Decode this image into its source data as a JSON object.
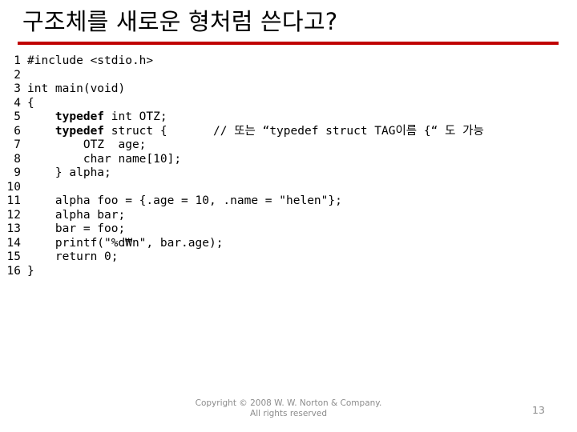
{
  "slide": {
    "title": "구조체를 새로운 형처럼 쓴다고?",
    "accent_color": "#C00000",
    "background_color": "#FFFFFF",
    "text_color": "#000000",
    "footer_color": "#8C8C8C"
  },
  "code": {
    "lines": [
      {
        "number": "1",
        "text": "#include <stdio.h>"
      },
      {
        "number": "2",
        "text": ""
      },
      {
        "number": "3",
        "text": "int main(void)"
      },
      {
        "number": "4",
        "text": "{"
      },
      {
        "number": "5",
        "keyword": "typedef",
        "text": " int OTZ;",
        "indent": "    "
      },
      {
        "number": "6",
        "keyword": "typedef",
        "text": " struct {",
        "indent": "    ",
        "comment": "// 또는 “typedef struct TAG이름 {“ 도 가능"
      },
      {
        "number": "7",
        "text": "        OTZ  age;"
      },
      {
        "number": "8",
        "text": "        char name[10];"
      },
      {
        "number": "9",
        "text": "    } alpha;"
      },
      {
        "number": "10",
        "text": ""
      },
      {
        "number": "11",
        "text": "    alpha foo = {.age = 10, .name = \"helen\"};"
      },
      {
        "number": "12",
        "text": "    alpha bar;"
      },
      {
        "number": "13",
        "text": "    bar = foo;"
      },
      {
        "number": "14",
        "text": "    printf(\"%d₩n\", bar.age);"
      },
      {
        "number": "15",
        "text": "    return 0;"
      },
      {
        "number": "16",
        "text": "}"
      }
    ]
  },
  "footer": {
    "copyright": "Copyright © 2008 W. W. Norton & Company.",
    "rights": "All rights reserved",
    "page_number": "13"
  }
}
